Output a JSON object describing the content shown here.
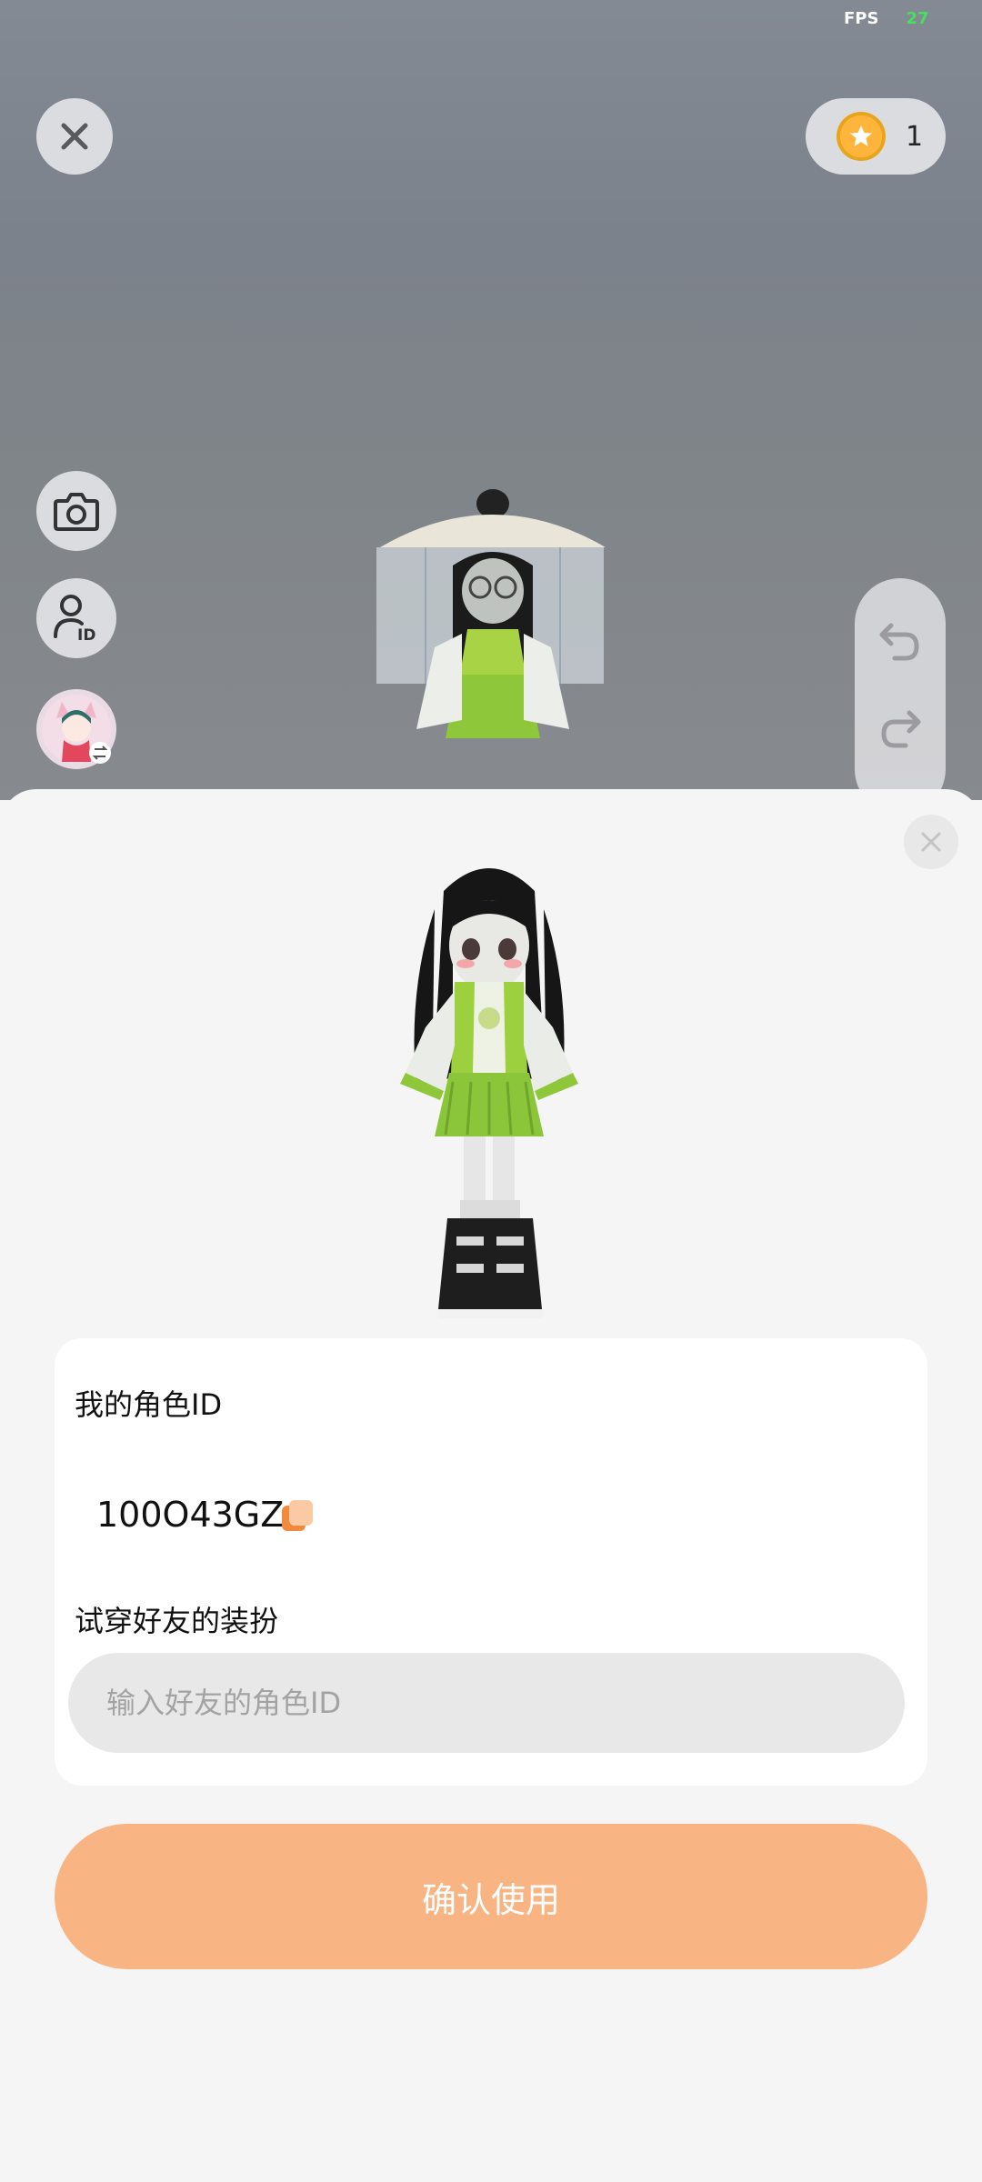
{
  "status": {
    "fps_label": "FPS",
    "fps_value": "27"
  },
  "top": {
    "coin_count": "1"
  },
  "sheet": {
    "my_id_label": "我的角色ID",
    "my_id_value": "100O43GZ",
    "try_on_label": "试穿好友的装扮",
    "friend_id_placeholder": "输入好友的角色ID",
    "friend_id_value": "",
    "confirm_label": "确认使用"
  },
  "colors": {
    "accent": "#f8b482",
    "copy_icon": "#f08a3c",
    "fps_value": "#46e05a",
    "coin": "#ffb53c"
  },
  "icons": [
    "close-icon",
    "coin-icon",
    "camera-icon",
    "user-id-icon",
    "avatar-switch-icon",
    "undo-icon",
    "redo-icon",
    "copy-icon"
  ]
}
